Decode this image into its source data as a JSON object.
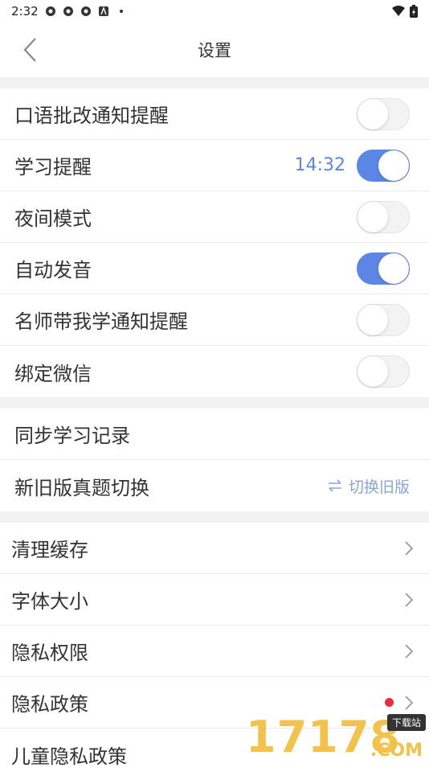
{
  "status_bar": {
    "time": "2:32"
  },
  "header": {
    "title": "设置"
  },
  "section1": [
    {
      "label": "口语批改通知提醒",
      "on": false
    },
    {
      "label": "学习提醒",
      "time": "14:32",
      "on": true
    },
    {
      "label": "夜间模式",
      "on": false
    },
    {
      "label": "自动发音",
      "on": true
    },
    {
      "label": "名师带我学通知提醒",
      "on": false
    },
    {
      "label": "绑定微信",
      "on": false
    }
  ],
  "section2": {
    "sync": "同步学习记录",
    "version_switch": {
      "label": "新旧版真题切换",
      "action": "切换旧版"
    }
  },
  "section3": [
    {
      "label": "清理缓存"
    },
    {
      "label": "字体大小"
    },
    {
      "label": "隐私权限"
    },
    {
      "label": "隐私政策",
      "badge": true
    },
    {
      "label": "儿童隐私政策"
    }
  ],
  "watermark": {
    "number": "17178",
    "domain": ".COM",
    "tag": "下载站"
  },
  "colors": {
    "accent": "#5b86e5",
    "badge": "#f0283c"
  }
}
